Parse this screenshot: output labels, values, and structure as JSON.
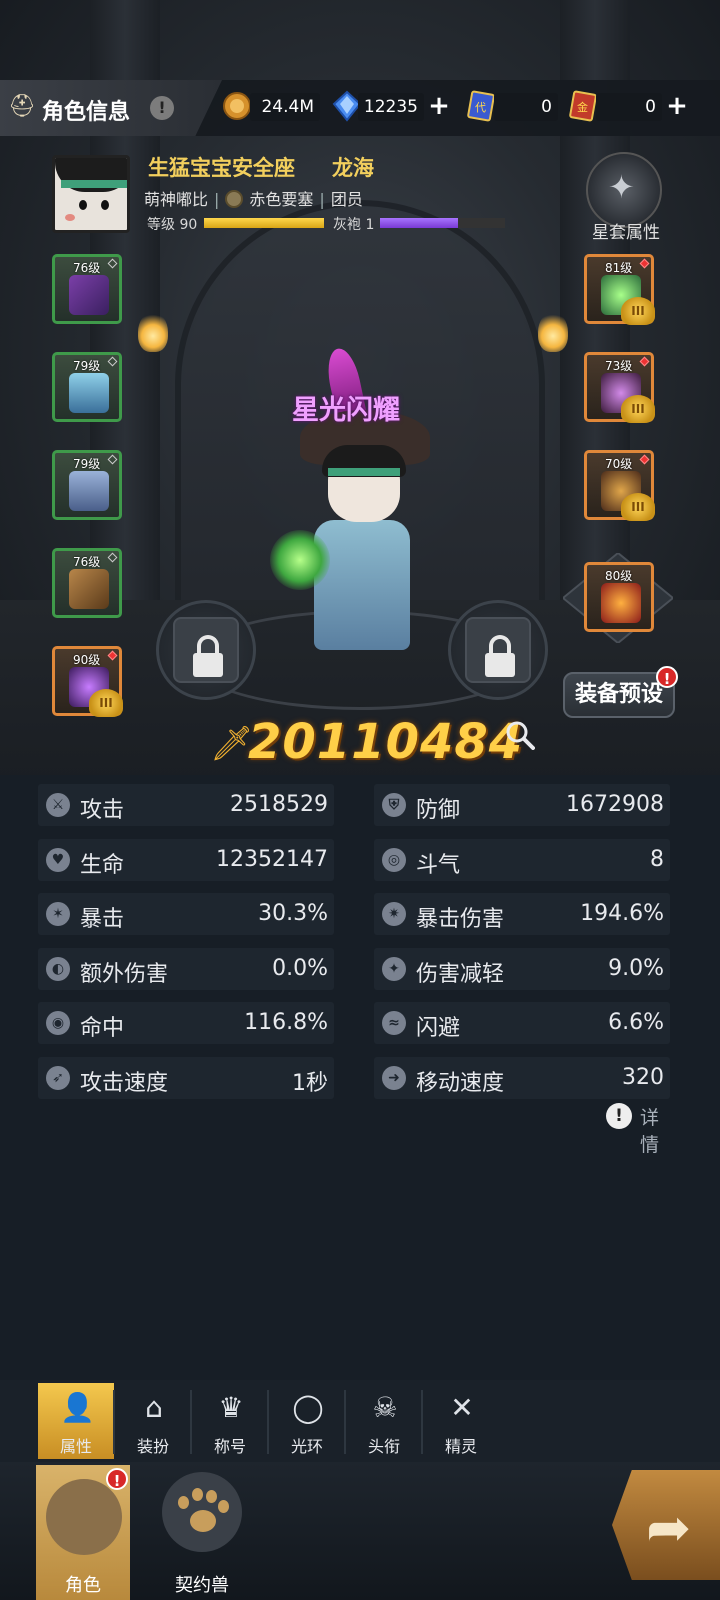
{
  "header": {
    "title": "角色信息",
    "help_glyph": "!",
    "currencies": [
      {
        "name": "gold",
        "value": "24.4M",
        "icon": "gold-coin-icon",
        "color": "#d6912c"
      },
      {
        "name": "diamond",
        "value": "12235",
        "icon": "blue-crystal-icon",
        "color": "#4a8cf0"
      },
      {
        "name": "ticket-blue",
        "value": "0",
        "icon": "blue-ticket-icon",
        "color": "#3a5ad0"
      },
      {
        "name": "ticket-gold",
        "value": "0",
        "icon": "red-gold-ticket-icon",
        "color": "#c23a2a"
      }
    ],
    "plus_glyph": "+"
  },
  "character": {
    "name": "生猛宝宝安全座",
    "class_name": "龙海",
    "guild_prefix": "萌神嘟比",
    "guild_name": "赤色要塞",
    "guild_role": "团员",
    "level_label": "等级 90",
    "level_progress": 1.0,
    "robe_label": "灰袍 1",
    "robe_progress": 0.62,
    "title_badge": "星光闪耀",
    "combat_power": "20110484",
    "star_set_label": "星套属性"
  },
  "equipment": {
    "left": [
      {
        "level": "76级",
        "color": "#3f9a4a",
        "item": "hat"
      },
      {
        "level": "79级",
        "color": "#3f9a4a",
        "item": "robe"
      },
      {
        "level": "79级",
        "color": "#3f9a4a",
        "item": "boots"
      },
      {
        "level": "76级",
        "color": "#3f9a4a",
        "item": "bracers"
      },
      {
        "level": "90级",
        "color": "#e0883a",
        "item": "cloak"
      }
    ],
    "right": [
      {
        "level": "81级",
        "color": "#e0883a",
        "item": "staff"
      },
      {
        "level": "73级",
        "color": "#e0883a",
        "item": "ring"
      },
      {
        "level": "70级",
        "color": "#e0883a",
        "item": "necklace"
      }
    ],
    "special": {
      "level": "80级",
      "item": "fire-amulet"
    },
    "crown_label": "III"
  },
  "buttons": {
    "equipment_preset": "装备预设",
    "alert_glyph": "!"
  },
  "stats": [
    {
      "label": "攻击",
      "value": "2518529",
      "icon": "attack-icon"
    },
    {
      "label": "防御",
      "value": "1672908",
      "icon": "defense-icon"
    },
    {
      "label": "生命",
      "value": "12352147",
      "icon": "heart-icon"
    },
    {
      "label": "斗气",
      "value": "8",
      "icon": "spiral-icon"
    },
    {
      "label": "暴击",
      "value": "30.3%",
      "icon": "crit-icon"
    },
    {
      "label": "暴击伤害",
      "value": "194.6%",
      "icon": "crit-damage-icon"
    },
    {
      "label": "额外伤害",
      "value": "0.0%",
      "icon": "extra-damage-icon"
    },
    {
      "label": "伤害减轻",
      "value": "9.0%",
      "icon": "damage-reduce-icon"
    },
    {
      "label": "命中",
      "value": "116.8%",
      "icon": "target-icon"
    },
    {
      "label": "闪避",
      "value": "6.6%",
      "icon": "dodge-icon"
    },
    {
      "label": "攻击速度",
      "value": "1秒",
      "icon": "attack-speed-icon"
    },
    {
      "label": "移动速度",
      "value": "320",
      "icon": "move-speed-icon"
    }
  ],
  "detail_label": "详情",
  "subtabs": [
    {
      "label": "属性",
      "icon": "person-icon",
      "active": true
    },
    {
      "label": "装扮",
      "icon": "hanger-icon",
      "active": false
    },
    {
      "label": "称号",
      "icon": "crown-icon",
      "active": false
    },
    {
      "label": "光环",
      "icon": "halo-icon",
      "active": false
    },
    {
      "label": "头衔",
      "icon": "skull-wings-icon",
      "active": false
    },
    {
      "label": "精灵",
      "icon": "crossed-spirit-icon",
      "active": false
    }
  ],
  "bottom_nav": [
    {
      "label": "角色",
      "icon": "character-head-icon",
      "active": true
    },
    {
      "label": "契约兽",
      "icon": "paw-icon",
      "active": false
    }
  ]
}
